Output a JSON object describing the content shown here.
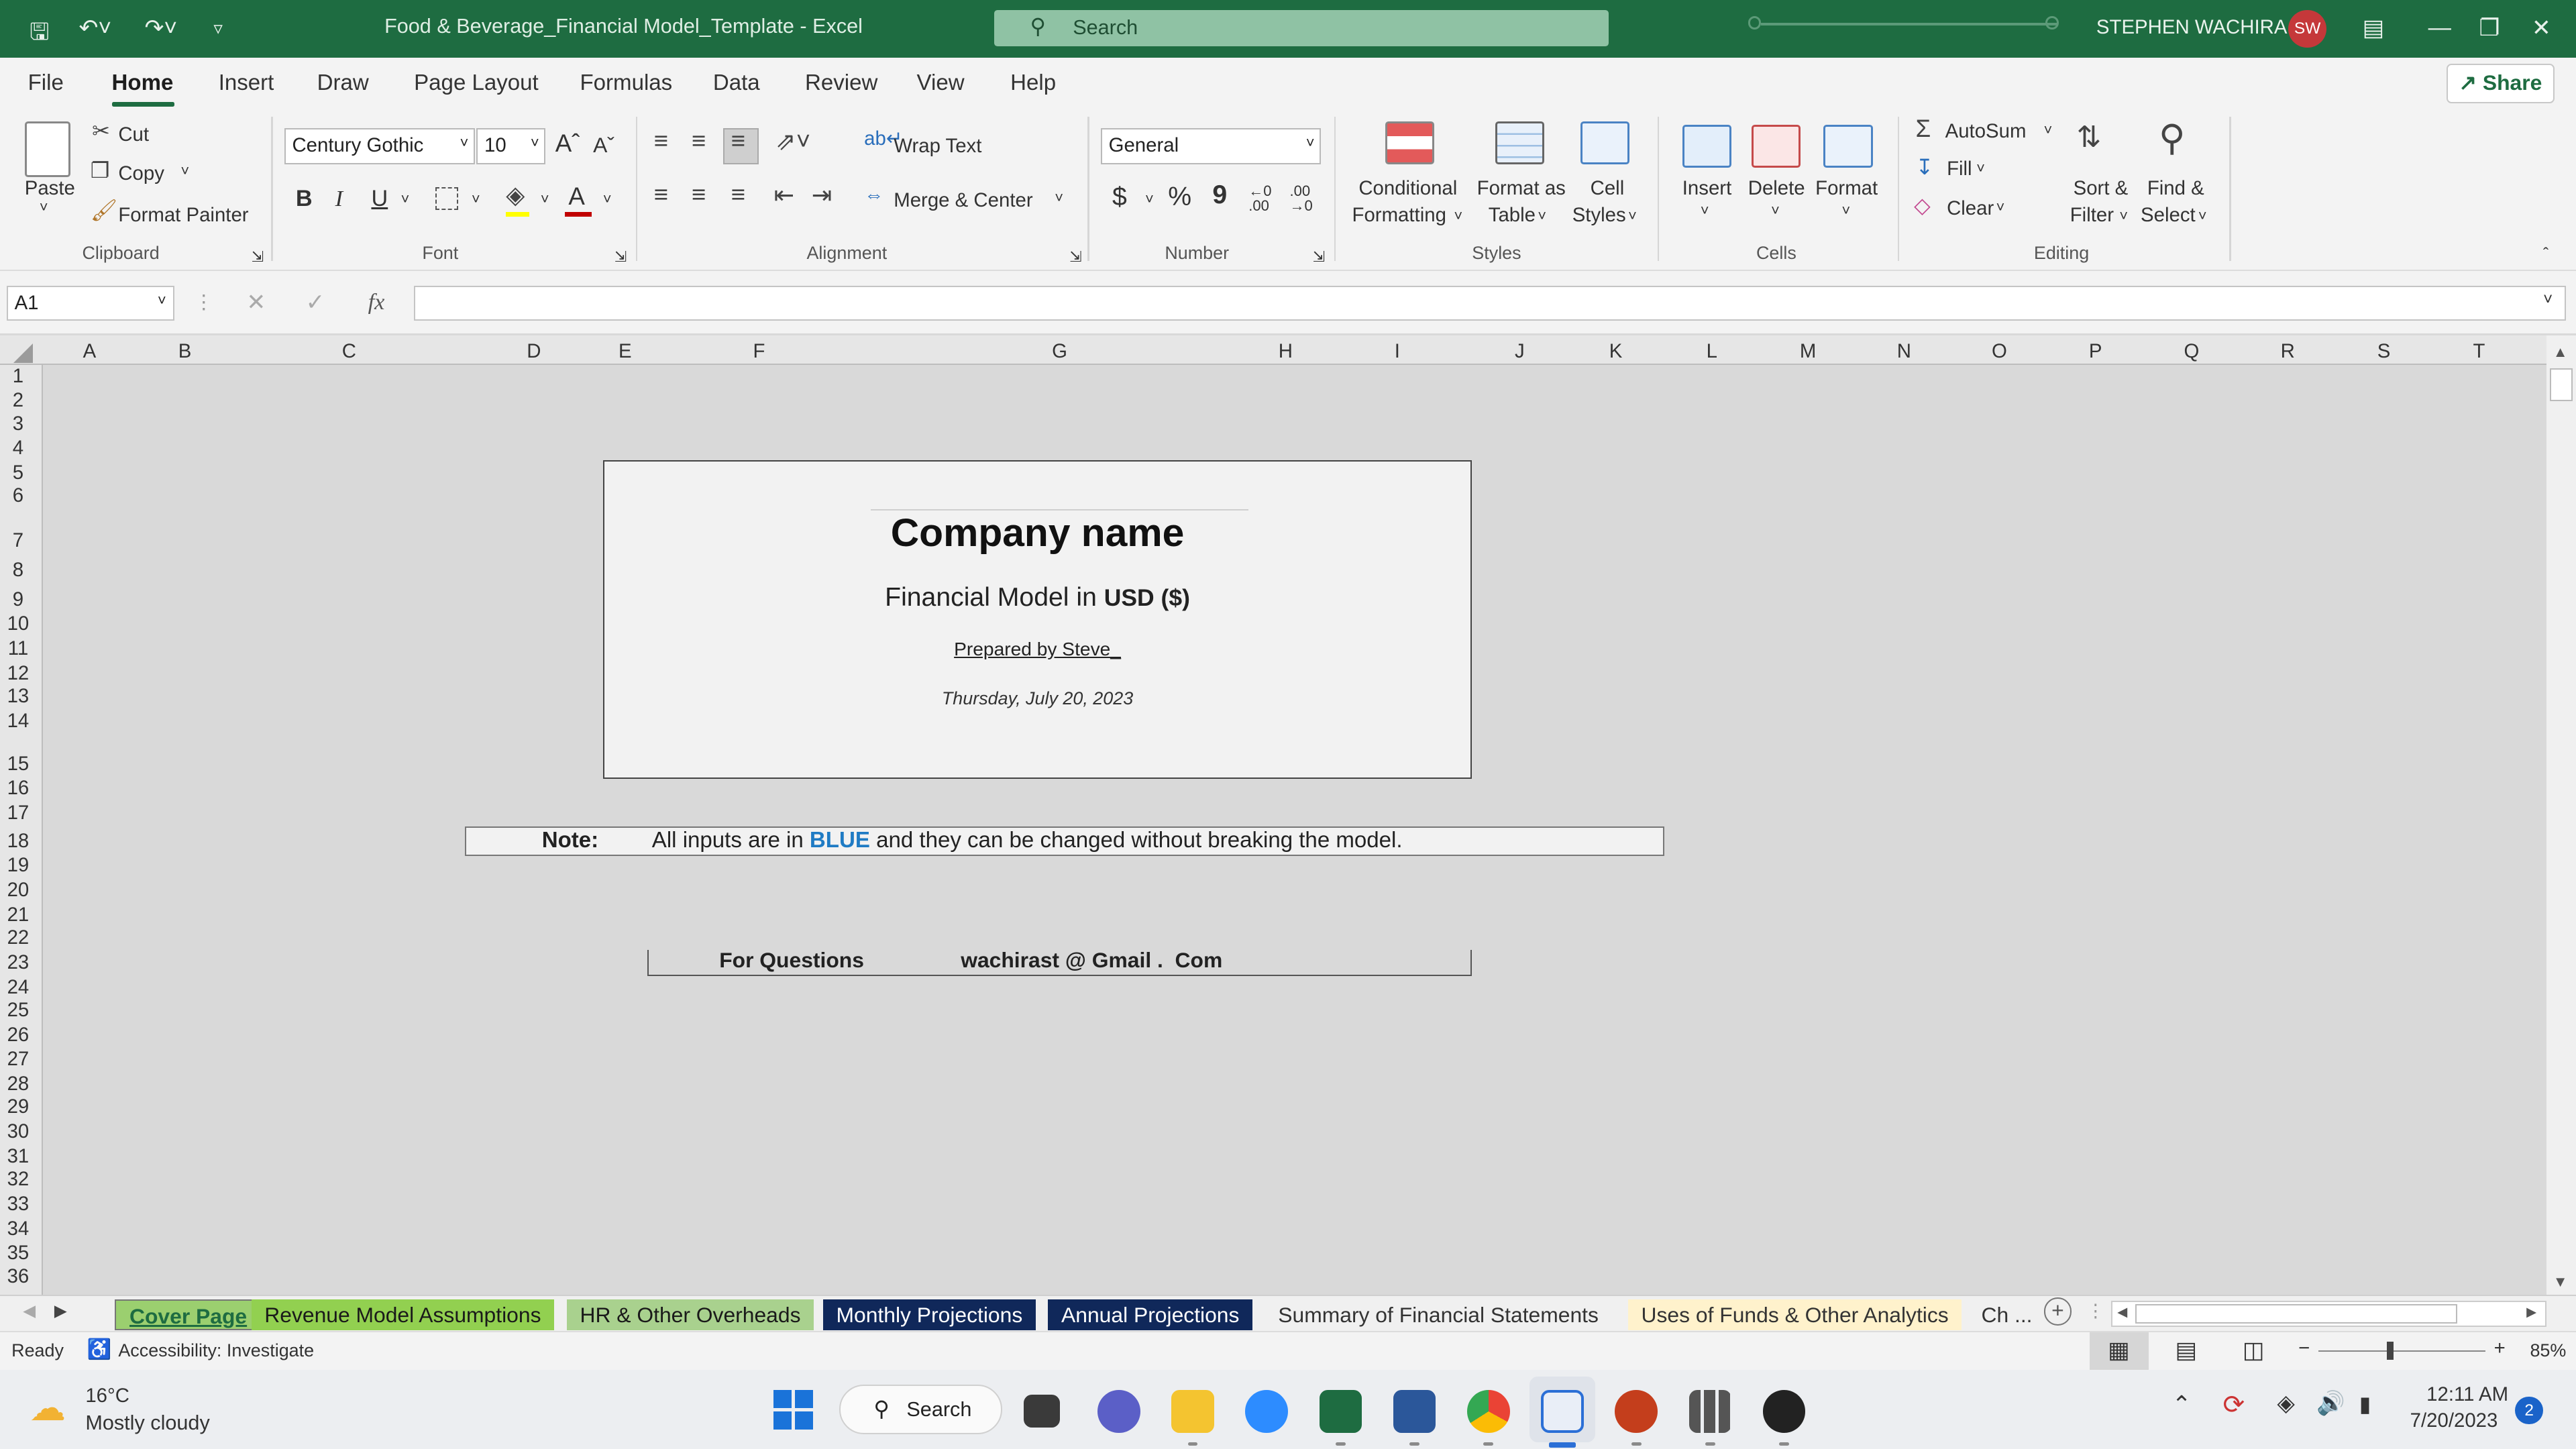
{
  "titlebar": {
    "document_title": "Food & Beverage_Financial Model_Template  -  Excel",
    "search_placeholder": "Search",
    "user_name": "STEPHEN WACHIRA",
    "user_initials": "SW",
    "accent_color": "#1e6c41"
  },
  "menu": {
    "tabs": [
      "File",
      "Home",
      "Insert",
      "Draw",
      "Page Layout",
      "Formulas",
      "Data",
      "Review",
      "View",
      "Help"
    ],
    "active_tab": "Home",
    "share_label": "Share"
  },
  "ribbon": {
    "clipboard": {
      "paste": "Paste",
      "cut": "Cut",
      "copy": "Copy",
      "format_painter": "Format Painter",
      "group": "Clipboard"
    },
    "font": {
      "family": "Century Gothic",
      "size": "10",
      "bold": "B",
      "italic": "I",
      "underline": "U",
      "group": "Font"
    },
    "alignment": {
      "wrap_text": "Wrap Text",
      "merge_center": "Merge & Center",
      "group": "Alignment"
    },
    "number": {
      "format": "General",
      "currency": "$",
      "percent": "%",
      "comma": "9",
      "group": "Number"
    },
    "styles": {
      "conditional_1": "Conditional",
      "conditional_2": "Formatting",
      "format_table_1": "Format as",
      "format_table_2": "Table",
      "cell_styles_1": "Cell",
      "cell_styles_2": "Styles",
      "group": "Styles"
    },
    "cells": {
      "insert": "Insert",
      "delete": "Delete",
      "format": "Format",
      "group": "Cells"
    },
    "editing": {
      "autosum": "AutoSum",
      "fill": "Fill",
      "clear": "Clear",
      "sort_1": "Sort &",
      "sort_2": "Filter",
      "find_1": "Find &",
      "find_2": "Select",
      "group": "Editing"
    }
  },
  "formula_bar": {
    "name_box": "A1",
    "fx": "fx",
    "formula": ""
  },
  "columns": [
    "A",
    "B",
    "C",
    "D",
    "E",
    "F",
    "G",
    "H",
    "I",
    "J",
    "K",
    "L",
    "M",
    "N",
    "O",
    "P",
    "Q",
    "R",
    "S",
    "T"
  ],
  "rows": [
    "1",
    "2",
    "3",
    "4",
    "5",
    "6",
    "7",
    "8",
    "9",
    "10",
    "11",
    "12",
    "13",
    "14",
    "15",
    "16",
    "17",
    "18",
    "19",
    "20",
    "21",
    "22",
    "23",
    "24",
    "25",
    "26",
    "27",
    "28",
    "29",
    "30",
    "31",
    "32",
    "33",
    "34",
    "35",
    "36"
  ],
  "cover": {
    "company_name": "Company name",
    "model_prefix": "Financial  Model in ",
    "currency_label": "USD ($)",
    "prepared_by": "Prepared by Steve_",
    "date": "Thursday, July 20, 2023"
  },
  "note": {
    "label": "Note:",
    "text_before": "All inputs are in ",
    "highlight": "BLUE",
    "text_after": " and they can be changed without breaking the model.",
    "highlight_color": "#1f7bc4"
  },
  "questions": {
    "label": "For Questions",
    "contact": "wachirast @ Gmail .  Com"
  },
  "sheet_tabs": [
    {
      "label": "Cover Page",
      "bg": "#9bcf6f",
      "color": "#1e6c41",
      "active": true
    },
    {
      "label": "Revenue Model Assumptions",
      "bg": "#92d050",
      "color": "#1a1a1a"
    },
    {
      "label": "HR & Other Overheads",
      "bg": "#a9d18e",
      "color": "#1a1a1a"
    },
    {
      "label": "Monthly Projections",
      "bg": "#10285a",
      "color": "#ffffff"
    },
    {
      "label": "Annual Projections",
      "bg": "#10285a",
      "color": "#ffffff"
    },
    {
      "label": "Summary of Financial Statements",
      "bg": "#f0f0f0",
      "color": "#333333"
    },
    {
      "label": "Uses of Funds & Other Analytics",
      "bg": "#fff2cc",
      "color": "#333333"
    },
    {
      "label": "Ch ...",
      "bg": "#f0f0f0",
      "color": "#333333"
    }
  ],
  "status": {
    "ready": "Ready",
    "accessibility": "Accessibility: Investigate",
    "zoom": "85%"
  },
  "taskbar": {
    "temperature": "16°C",
    "weather": "Mostly cloudy",
    "search": "Search",
    "time": "12:11 AM",
    "date": "7/20/2023",
    "notifications": "2"
  }
}
